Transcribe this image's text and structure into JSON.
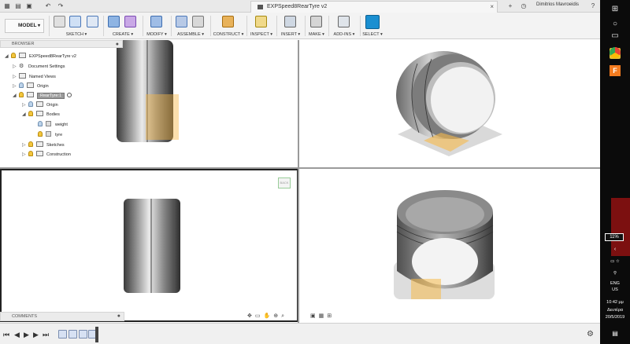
{
  "titlebar": {
    "doc_title": "EXPSpeed8RearTyre v2",
    "user": "Dimitrios Mavroeidis",
    "new_tab": "+",
    "close_tab": "×"
  },
  "toolbar": {
    "workspace": "MODEL",
    "groups": [
      {
        "label": "SKETCH ▾"
      },
      {
        "label": "CREATE ▾"
      },
      {
        "label": "MODIFY ▾"
      },
      {
        "label": "ASSEMBLE ▾"
      },
      {
        "label": "CONSTRUCT ▾"
      },
      {
        "label": "INSPECT ▾"
      },
      {
        "label": "INSERT ▾"
      },
      {
        "label": "MAKE ▾"
      },
      {
        "label": "ADD-INS ▾"
      },
      {
        "label": "SELECT ▾"
      }
    ]
  },
  "browser": {
    "header": "BROWSER",
    "root": "EXPSpeed8RearTyre v2",
    "items": {
      "document_settings": "Document Settings",
      "named_views": "Named Views",
      "origin": "Origin",
      "component": "RearTyre:1",
      "comp_origin": "Origin",
      "bodies": "Bodies",
      "body_weight": "weight",
      "body_tyre": "tyre",
      "sketches": "Sketches",
      "construction": "Construction"
    }
  },
  "viewcube_label": "BACK",
  "comments": {
    "header": "COMMENTS"
  },
  "taskbar": {
    "battery": "11%",
    "lang": "ENG",
    "region": "US",
    "time": "10:42 μμ",
    "day": "Δευτέρα",
    "date": "20/5/2019"
  },
  "colors": {
    "accent_select": "#1a8fd1",
    "highlight": "#f6b94a",
    "active_component": "#9a9a9a"
  }
}
